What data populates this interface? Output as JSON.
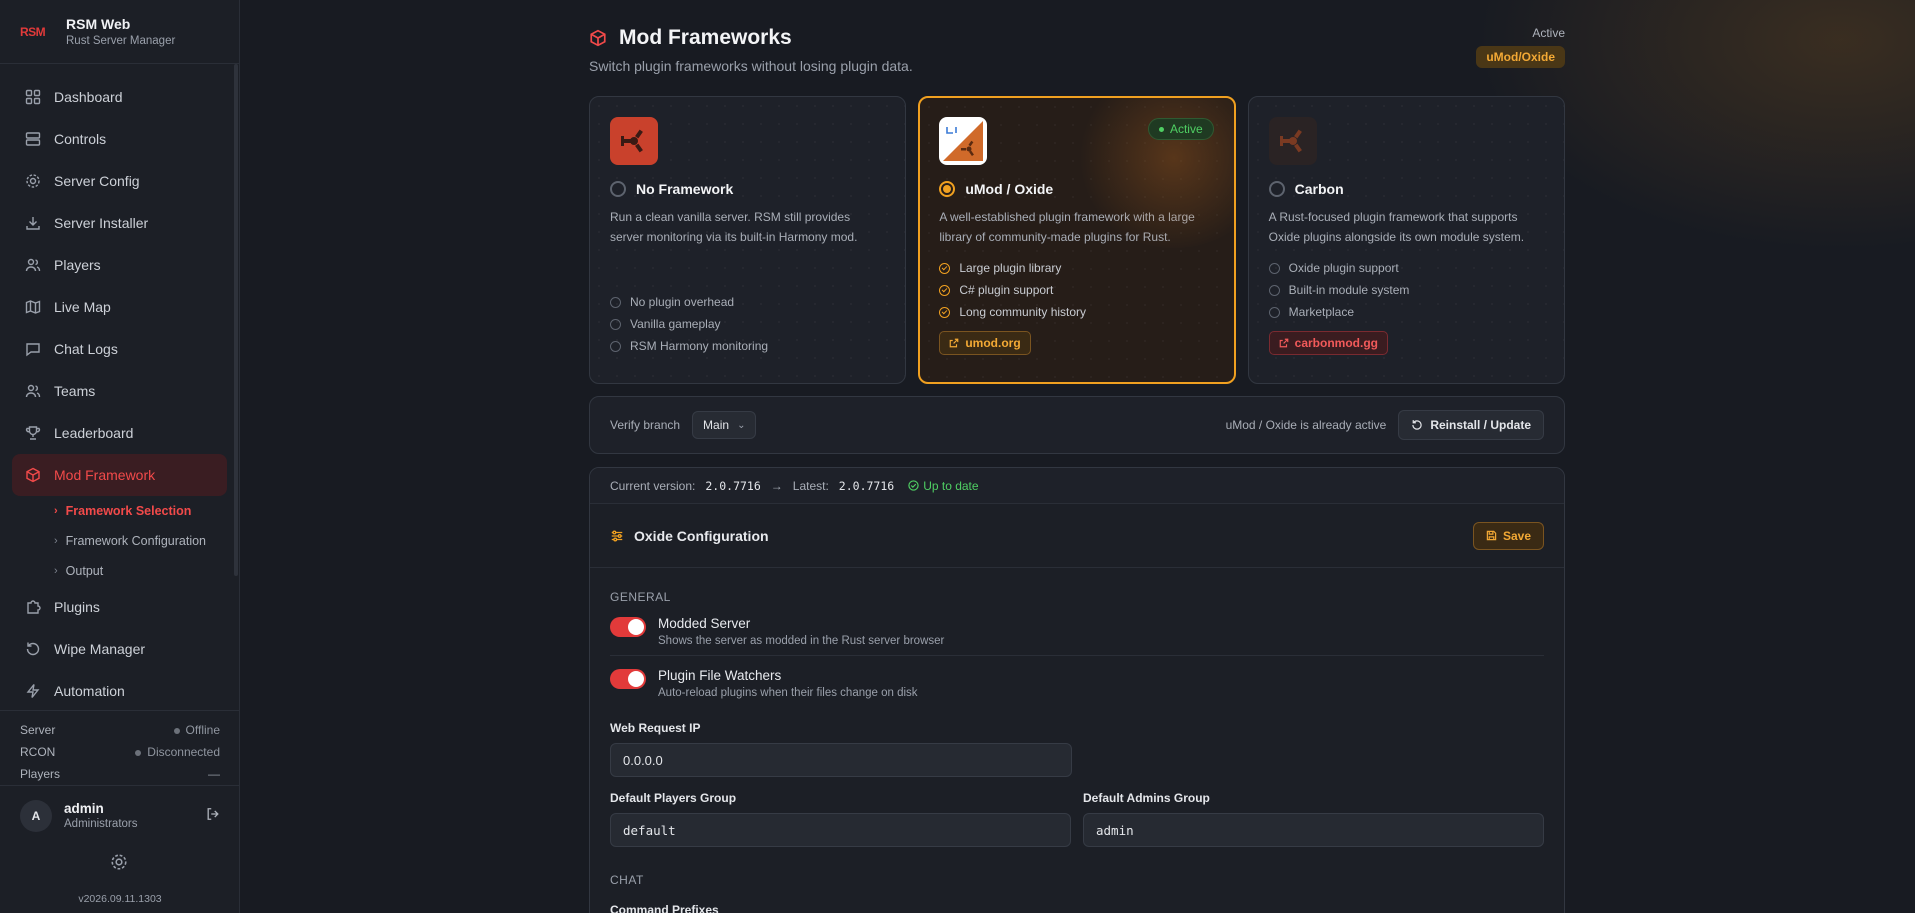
{
  "brand": {
    "logo": "RSM",
    "title": "RSM Web",
    "subtitle": "Rust Server Manager"
  },
  "nav": {
    "items": [
      {
        "label": "Dashboard",
        "icon": "dashboard-icon"
      },
      {
        "label": "Controls",
        "icon": "server-icon"
      },
      {
        "label": "Server Config",
        "icon": "gear-icon"
      },
      {
        "label": "Server Installer",
        "icon": "download-icon"
      },
      {
        "label": "Players",
        "icon": "users-icon"
      },
      {
        "label": "Live Map",
        "icon": "map-icon"
      },
      {
        "label": "Chat Logs",
        "icon": "chat-icon"
      },
      {
        "label": "Teams",
        "icon": "team-icon"
      },
      {
        "label": "Leaderboard",
        "icon": "trophy-icon"
      },
      {
        "label": "Mod Framework",
        "icon": "cube-icon",
        "active": true
      },
      {
        "label": "Plugins",
        "icon": "puzzle-icon"
      },
      {
        "label": "Wipe Manager",
        "icon": "reset-icon"
      },
      {
        "label": "Automation",
        "icon": "bolt-icon"
      }
    ],
    "sub_items": [
      "Framework Selection",
      "Framework Configuration",
      "Output"
    ]
  },
  "status": {
    "server_label": "Server",
    "server_value": "Offline",
    "rcon_label": "RCON",
    "rcon_value": "Disconnected",
    "players_label": "Players",
    "players_value": "—"
  },
  "user": {
    "initial": "A",
    "name": "admin",
    "role": "Administrators"
  },
  "version": "v2026.09.11.1303",
  "page": {
    "title": "Mod Frameworks",
    "subtitle": "Switch plugin frameworks without losing plugin data.",
    "active_label": "Active",
    "active_value": "uMod/Oxide"
  },
  "frameworks": [
    {
      "name": "No Framework",
      "desc": "Run a clean vanilla server. RSM still provides server monitoring via its built-in Harmony mod.",
      "features": [
        "No plugin overhead",
        "Vanilla gameplay",
        "RSM Harmony monitoring"
      ]
    },
    {
      "name": "uMod / Oxide",
      "desc": "A well-established plugin framework with a large library of community-made plugins for Rust.",
      "features": [
        "Large plugin library",
        "C# plugin support",
        "Long community history"
      ],
      "link": "umod.org",
      "chip": "Active"
    },
    {
      "name": "Carbon",
      "desc": "A Rust-focused plugin framework that supports Oxide plugins alongside its own module system.",
      "features": [
        "Oxide plugin support",
        "Built-in module system",
        "Marketplace"
      ],
      "link": "carbonmod.gg"
    }
  ],
  "branch": {
    "label": "Verify branch",
    "value": "Main",
    "status": "uMod / Oxide is already active",
    "reinstall_label": "Reinstall / Update"
  },
  "config": {
    "current_label": "Current version:",
    "current_value": "2.0.7716",
    "arrow": "→",
    "latest_label": "Latest:",
    "latest_value": "2.0.7716",
    "up_to_date": "Up to date",
    "title": "Oxide Configuration",
    "save_label": "Save",
    "general_label": "GENERAL",
    "modded_title": "Modded Server",
    "modded_desc": "Shows the server as modded in the Rust server browser",
    "watchers_title": "Plugin File Watchers",
    "watchers_desc": "Auto-reload plugins when their files change on disk",
    "web_ip_label": "Web Request IP",
    "web_ip_value": "0.0.0.0",
    "players_group_label": "Default Players Group",
    "players_group_value": "default",
    "admins_group_label": "Default Admins Group",
    "admins_group_value": "admin",
    "chat_label": "CHAT",
    "command_prefixes_label": "Command Prefixes"
  },
  "colors": {
    "accent": "#f24a4a",
    "umod": "#f0a020",
    "success": "#4fcf63"
  }
}
